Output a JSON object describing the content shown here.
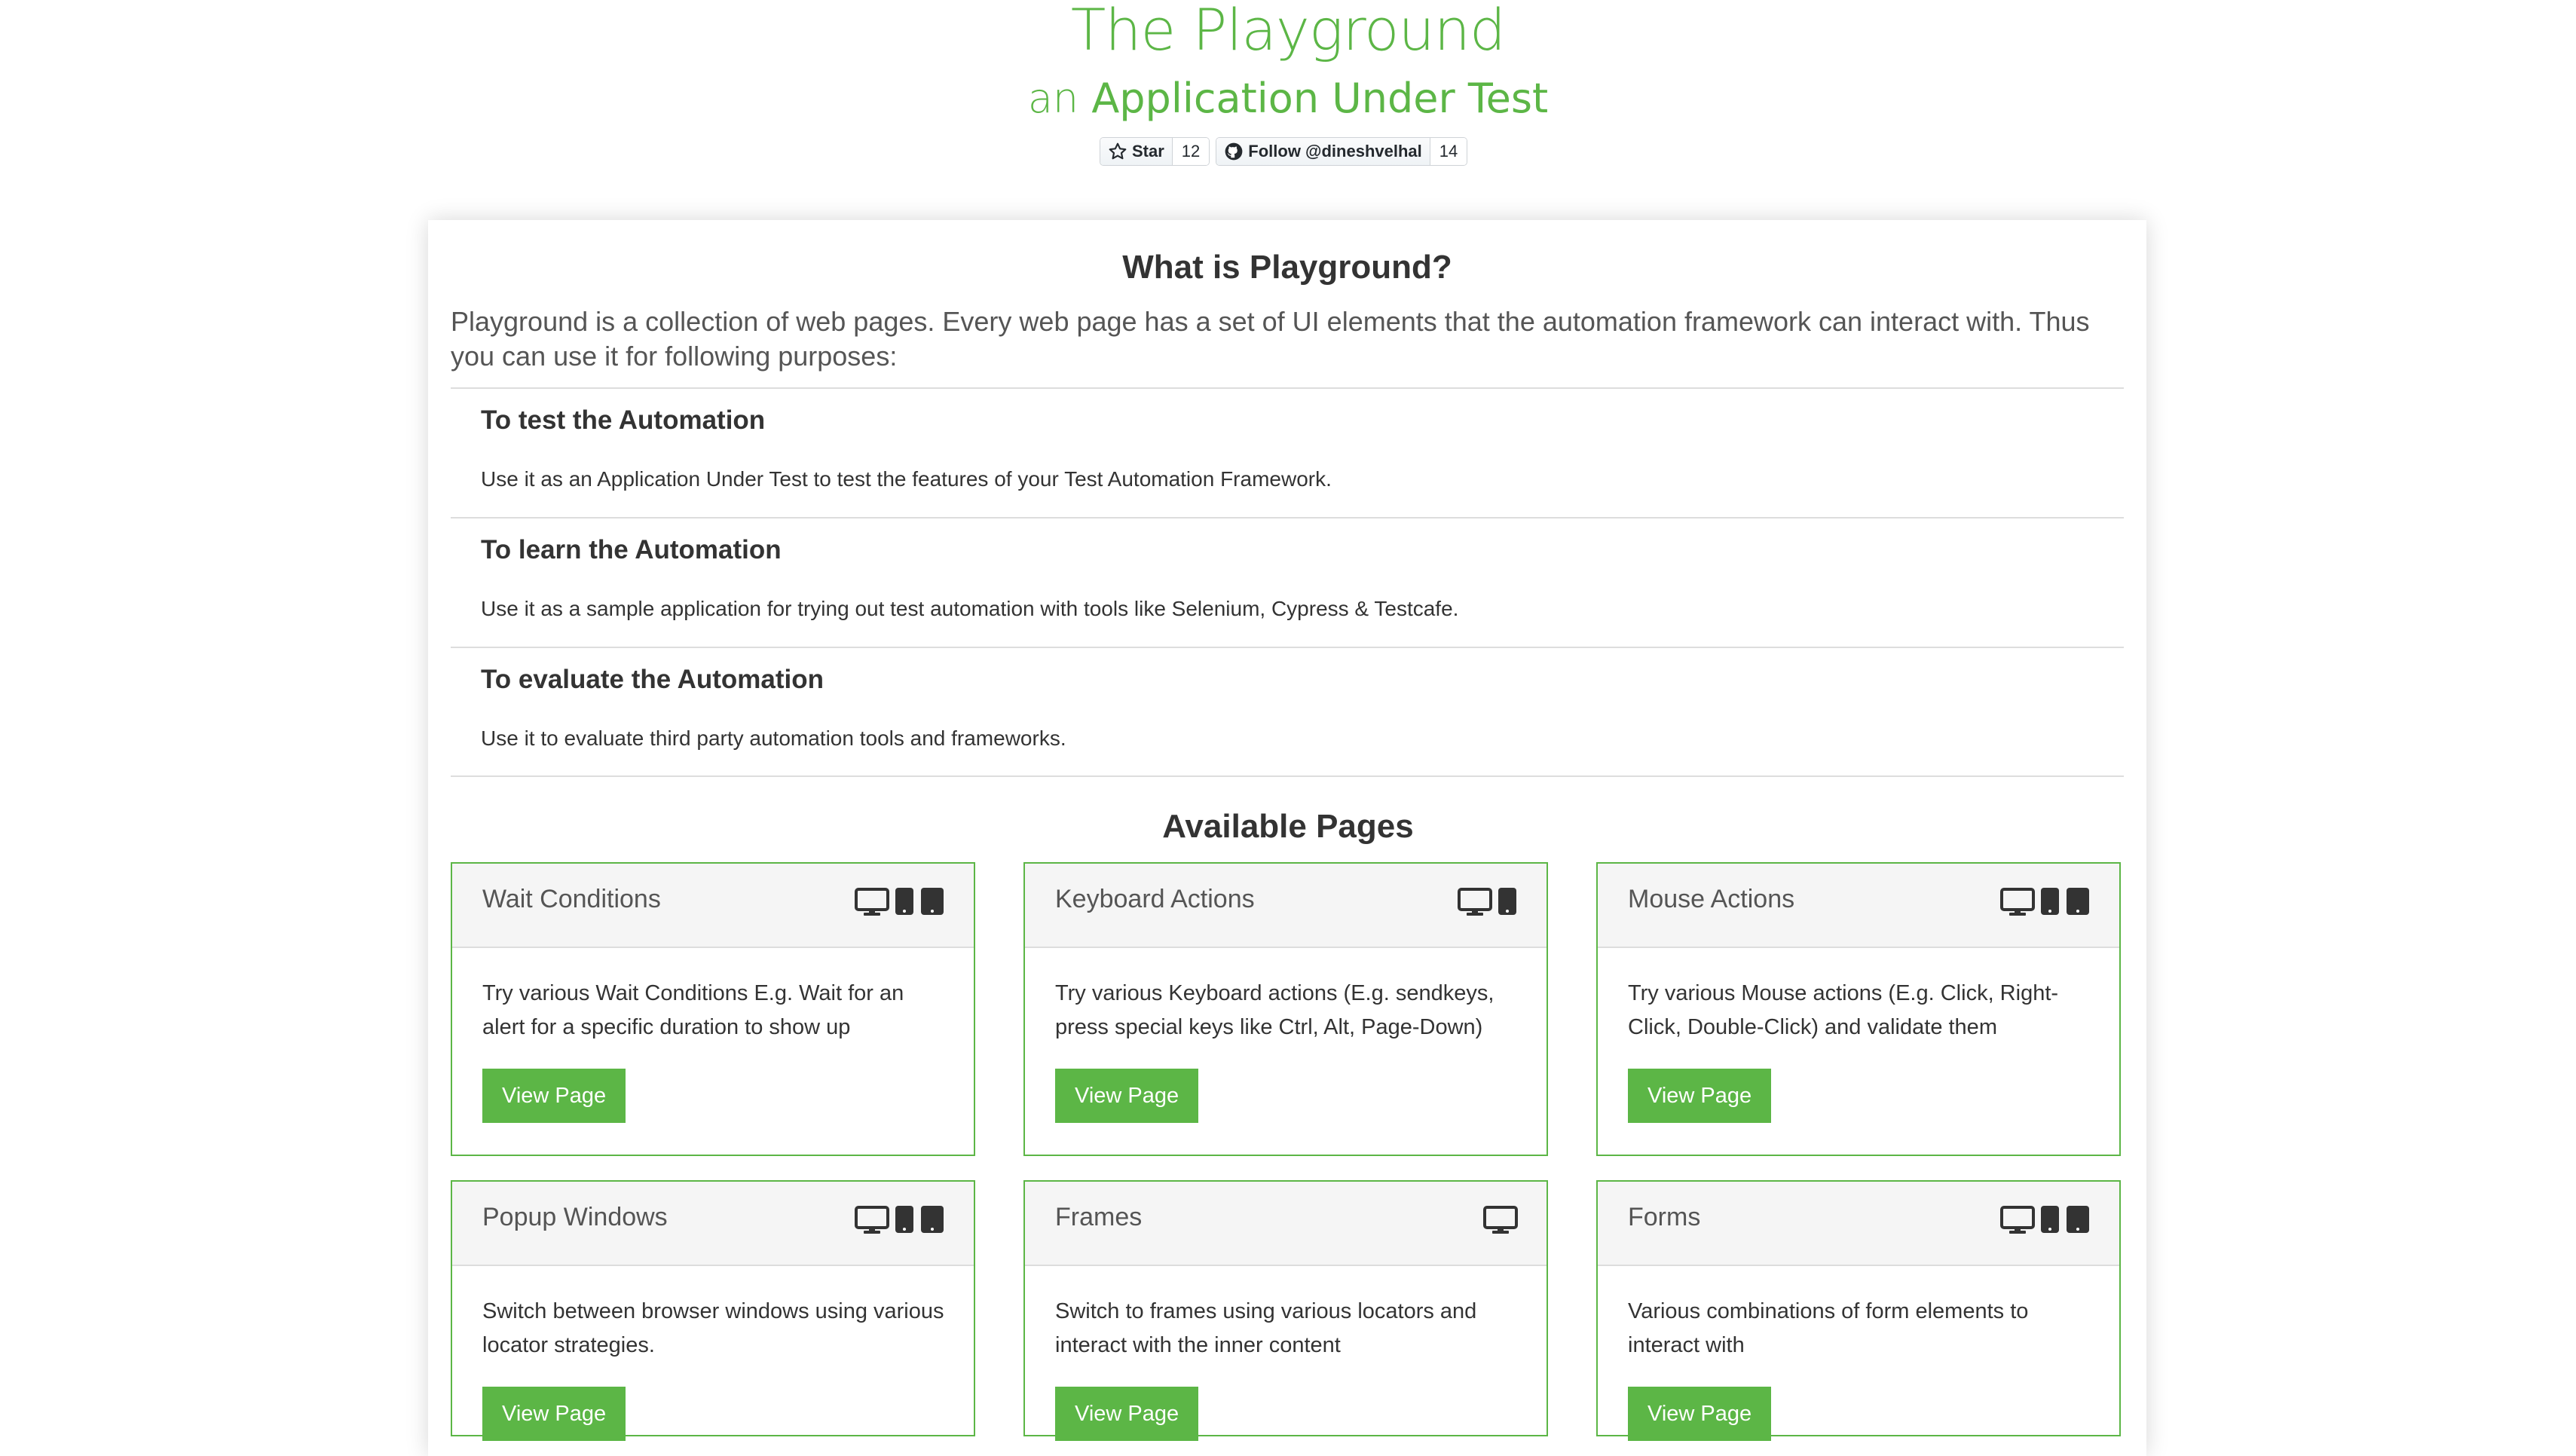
{
  "header": {
    "title": "The Playground",
    "subtitle_prefix": "an",
    "subtitle_main": "Application Under Test",
    "github": {
      "star_label": "Star",
      "star_count": "12",
      "follow_label": "Follow @dineshvelhal",
      "follow_count": "14"
    }
  },
  "about": {
    "heading": "What is Playground?",
    "intro": "Playground is a collection of web pages. Every web page has a set of UI elements that the automation framework can interact with. Thus you can use it for following purposes:",
    "purposes": [
      {
        "title": "To test the Automation",
        "description": "Use it as an Application Under Test to test the features of your Test Automation Framework."
      },
      {
        "title": "To learn the Automation",
        "description": "Use it as a sample application for trying out test automation with tools like Selenium, Cypress & Testcafe."
      },
      {
        "title": "To evaluate the Automation",
        "description": "Use it to evaluate third party automation tools and frameworks."
      }
    ]
  },
  "pages": {
    "heading": "Available Pages",
    "button_label": "View Page",
    "items": [
      {
        "name": "Wait Conditions",
        "description": "Try various Wait Conditions E.g. Wait for an alert for a specific duration to show up",
        "icons": [
          "desktop-icon",
          "tablet-icon",
          "mobile-icon"
        ]
      },
      {
        "name": "Keyboard Actions",
        "description": "Try various Keyboard actions (E.g. sendkeys, press special keys like Ctrl, Alt, Page-Down)",
        "icons": [
          "desktop-icon",
          "tablet-icon"
        ]
      },
      {
        "name": "Mouse Actions",
        "description": "Try various Mouse actions (E.g. Click, Right-Click, Double-Click) and validate them",
        "icons": [
          "desktop-icon",
          "tablet-icon",
          "mobile-icon"
        ]
      },
      {
        "name": "Popup Windows",
        "description": "Switch between browser windows using various locator strategies.",
        "icons": [
          "desktop-icon",
          "tablet-icon",
          "mobile-icon"
        ]
      },
      {
        "name": "Frames",
        "description": "Switch to frames using various locators and interact with the inner content",
        "icons": [
          "desktop-icon"
        ]
      },
      {
        "name": "Forms",
        "description": "Various combinations of form elements to interact with",
        "icons": [
          "desktop-icon",
          "tablet-icon",
          "mobile-icon"
        ]
      }
    ]
  },
  "colors": {
    "accent": "#5cb646",
    "text": "#333333",
    "muted": "#555555",
    "card_header": "#f5f5f5",
    "divider": "#dddddd"
  }
}
